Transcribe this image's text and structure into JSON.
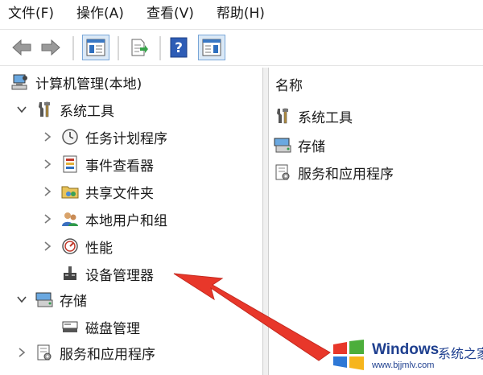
{
  "menubar": {
    "items": [
      "文件(F)",
      "操作(A)",
      "查看(V)",
      "帮助(H)"
    ]
  },
  "tree": {
    "root": "计算机管理(本地)",
    "system_tools": "系统工具",
    "task_scheduler": "任务计划程序",
    "event_viewer": "事件查看器",
    "shared_folders": "共享文件夹",
    "local_users_groups": "本地用户和组",
    "performance": "性能",
    "device_manager": "设备管理器",
    "storage": "存储",
    "disk_management": "磁盘管理",
    "services_apps": "服务和应用程序"
  },
  "right_pane": {
    "column_header": "名称",
    "items": [
      "系统工具",
      "存储",
      "服务和应用程序"
    ]
  },
  "watermark": {
    "brand": "Windows",
    "site_name": "系统之家",
    "url": "www.bjjmlv.com"
  },
  "colors": {
    "arrow": "#e8372a",
    "watermark_text": "#1e3f8f"
  }
}
